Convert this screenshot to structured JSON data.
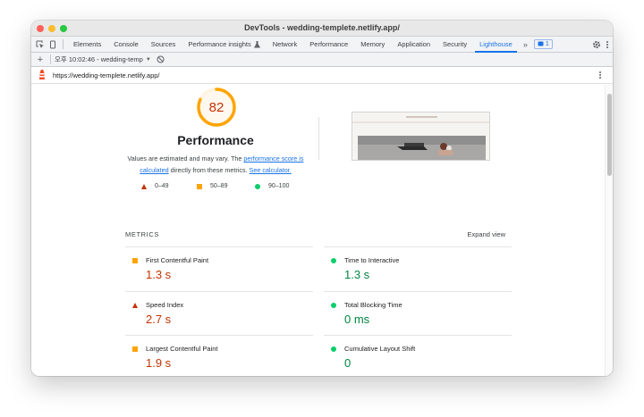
{
  "window": {
    "title": "DevTools - wedding-templete.netlify.app/"
  },
  "tabs": [
    {
      "label": "Elements"
    },
    {
      "label": "Console"
    },
    {
      "label": "Sources"
    },
    {
      "label": "Performance insights"
    },
    {
      "label": "Network"
    },
    {
      "label": "Performance"
    },
    {
      "label": "Memory"
    },
    {
      "label": "Application"
    },
    {
      "label": "Security"
    },
    {
      "label": "Lighthouse",
      "active": true
    }
  ],
  "issues_count": "1",
  "report_selector": "오후 10:02:46 - wedding-temp",
  "url": "https://wedding-templete.netlify.app/",
  "performance": {
    "score": "82",
    "score_fraction": 0.82,
    "title": "Performance",
    "desc_prefix": "Values are estimated and may vary. The ",
    "desc_link1": "performance score is calculated",
    "desc_middle": " directly from these metrics. ",
    "desc_link2": "See calculator."
  },
  "legend": [
    {
      "range": "0–49",
      "shape": "triangle",
      "color": "#c33300"
    },
    {
      "range": "50–89",
      "shape": "square",
      "color": "#ffa400"
    },
    {
      "range": "90–100",
      "shape": "circle",
      "color": "#0cce6b"
    }
  ],
  "metrics_heading": "METRICS",
  "expand_view": "Expand view",
  "metrics_left": [
    {
      "label": "First Contentful Paint",
      "value": "1.3 s",
      "status": "average"
    },
    {
      "label": "Speed Index",
      "value": "2.7 s",
      "status": "fail"
    },
    {
      "label": "Largest Contentful Paint",
      "value": "1.9 s",
      "status": "average"
    }
  ],
  "metrics_right": [
    {
      "label": "Time to Interactive",
      "value": "1.3 s",
      "status": "pass"
    },
    {
      "label": "Total Blocking Time",
      "value": "0 ms",
      "status": "pass"
    },
    {
      "label": "Cumulative Layout Shift",
      "value": "0",
      "status": "pass"
    }
  ],
  "colors": {
    "fail": "#c33300",
    "average": "#ffa400",
    "pass": "#0cce6b",
    "accent": "#1a73e8"
  }
}
